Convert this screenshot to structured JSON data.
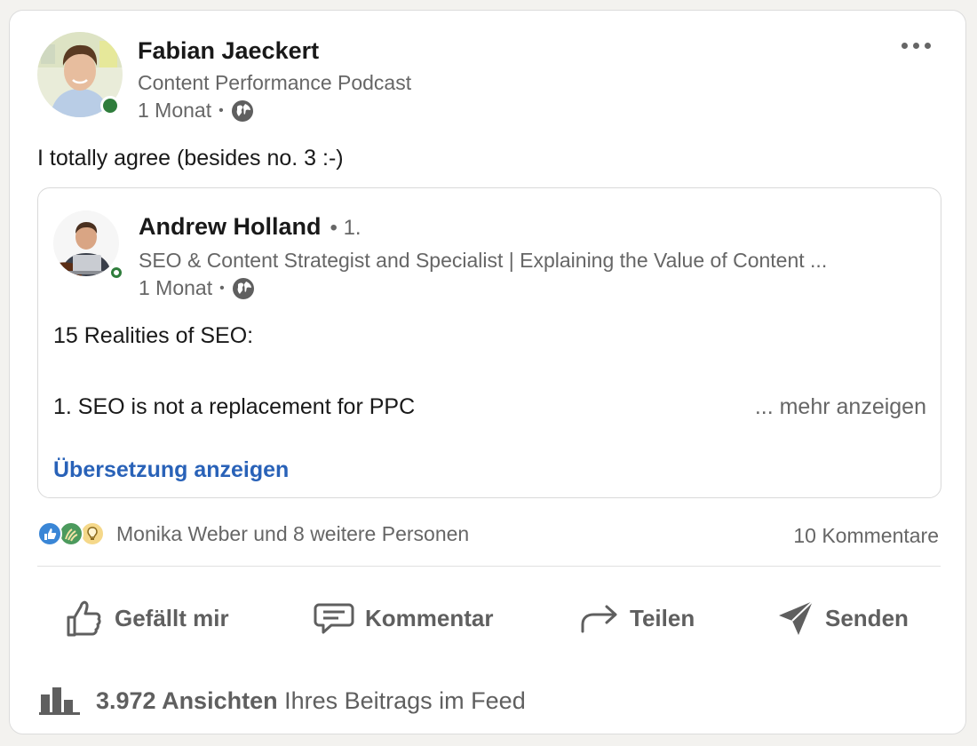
{
  "post": {
    "author": {
      "name": "Fabian Jaeckert",
      "headline": "Content Performance Podcast",
      "time": "1 Monat",
      "separator": "•"
    },
    "text": "I totally agree (besides no. 3 :-)",
    "more_icon": "ellipsis-icon",
    "visibility_icon": "globe-icon"
  },
  "shared": {
    "author": {
      "name": "Andrew Holland",
      "degree": "• 1.",
      "headline": "SEO & Content Strategist and Specialist | Explaining the Value of Content ...",
      "time": "1 Monat",
      "separator": "•"
    },
    "line1": "15 Realities of SEO:",
    "line2": "1. SEO is not a replacement for PPC",
    "more_label": "... mehr anzeigen",
    "translate_label": "Übersetzung anzeigen"
  },
  "social": {
    "reactions_text": "Monika Weber und 8 weitere Personen",
    "comments": "10 Kommentare",
    "reaction_icons": [
      "like-icon",
      "celebrate-icon",
      "insightful-icon"
    ]
  },
  "actions": {
    "like": "Gefällt mir",
    "comment": "Kommentar",
    "share": "Teilen",
    "send": "Senden"
  },
  "views": {
    "count": "3.972 Ansichten",
    "suffix": " Ihres Beitrags im Feed"
  },
  "colors": {
    "link": "#2962b8",
    "presence": "#2f7d3c",
    "muted": "#666666"
  }
}
